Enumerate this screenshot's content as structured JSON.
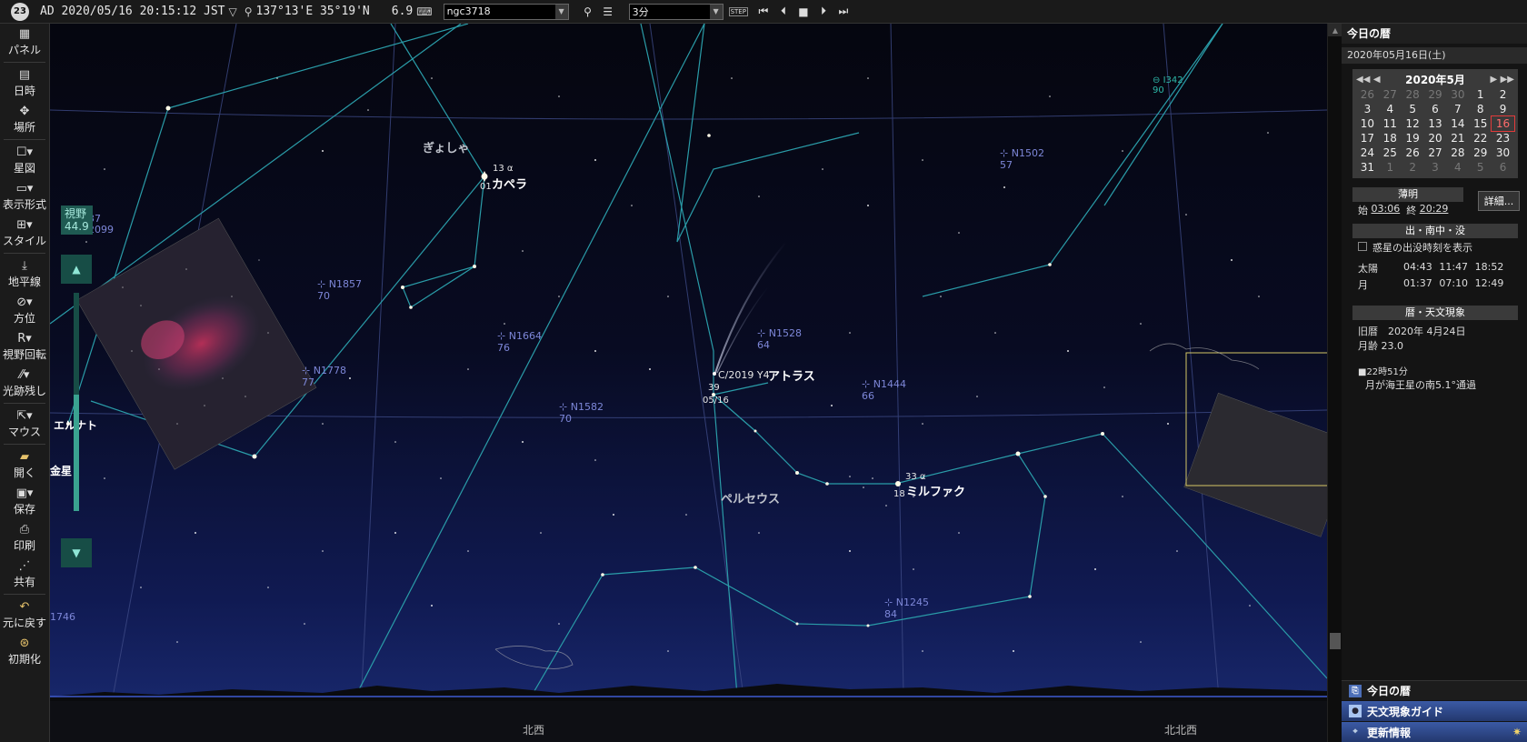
{
  "topbar": {
    "logo_text": "23",
    "datetime": "AD 2020/05/16 20:15:12 JST",
    "location": "137°13'E 35°19'N",
    "fov": "6.9",
    "search_value": "ngc3718",
    "step_value": "3分",
    "step_badge": "STEP"
  },
  "left_toolbar": {
    "items": [
      "パネル",
      "日時",
      "場所",
      "星図",
      "表示形式",
      "スタイル",
      "地平線",
      "方位",
      "視野回転",
      "光跡残し",
      "マウス",
      "開く",
      "保存",
      "印刷",
      "共有",
      "元に戻す",
      "初期化"
    ]
  },
  "sky_controls": {
    "fov_label": "視野",
    "fov_value": "44.9"
  },
  "sky_labels": {
    "constellation_auriga": "ぎょしゃ",
    "constellation_perseus": "ペルセウス",
    "capella_id": "13 α",
    "capella_mag": "01",
    "capella_name": "カペラ",
    "mirfak_id": "33 α",
    "mirfak_mag": "18",
    "mirfak_name": "ミルファク",
    "comet_name": "C/2019 Y4",
    "comet_jp": "アトラス",
    "comet_mag": "39",
    "comet_date": "05/16",
    "venus": "金星",
    "left_partial": "エルナト",
    "dir_nw": "北西",
    "dir_nnw": "北北西",
    "dso": [
      {
        "name": "N1857",
        "mag": "70"
      },
      {
        "name": "N1664",
        "mag": "76"
      },
      {
        "name": "N1778",
        "mag": "77"
      },
      {
        "name": "N1582",
        "mag": "70"
      },
      {
        "name": "N1528",
        "mag": "64"
      },
      {
        "name": "N1444",
        "mag": "66"
      },
      {
        "name": "N1502",
        "mag": "57"
      },
      {
        "name": "N1245",
        "mag": "84"
      },
      {
        "name": "I342",
        "mag": "90"
      }
    ],
    "left_edge_1": "1746",
    "left_edge_2": "37",
    "left_edge_3": "2099"
  },
  "right_panel": {
    "title": "今日の暦",
    "date": "2020年05月16日(土)",
    "calendar": {
      "month_label": "2020年5月",
      "days": [
        {
          "d": "26",
          "dim": true
        },
        {
          "d": "27",
          "dim": true
        },
        {
          "d": "28",
          "dim": true
        },
        {
          "d": "29",
          "dim": true
        },
        {
          "d": "30",
          "dim": true
        },
        {
          "d": "1"
        },
        {
          "d": "2"
        },
        {
          "d": "3"
        },
        {
          "d": "4"
        },
        {
          "d": "5"
        },
        {
          "d": "6"
        },
        {
          "d": "7"
        },
        {
          "d": "8"
        },
        {
          "d": "9"
        },
        {
          "d": "10"
        },
        {
          "d": "11"
        },
        {
          "d": "12"
        },
        {
          "d": "13"
        },
        {
          "d": "14"
        },
        {
          "d": "15"
        },
        {
          "d": "16",
          "today": true
        },
        {
          "d": "17"
        },
        {
          "d": "18"
        },
        {
          "d": "19"
        },
        {
          "d": "20"
        },
        {
          "d": "21"
        },
        {
          "d": "22"
        },
        {
          "d": "23"
        },
        {
          "d": "24"
        },
        {
          "d": "25"
        },
        {
          "d": "26"
        },
        {
          "d": "27"
        },
        {
          "d": "28"
        },
        {
          "d": "29"
        },
        {
          "d": "30"
        },
        {
          "d": "31"
        },
        {
          "d": "1",
          "dim": true
        },
        {
          "d": "2",
          "dim": true
        },
        {
          "d": "3",
          "dim": true
        },
        {
          "d": "4",
          "dim": true
        },
        {
          "d": "5",
          "dim": true
        },
        {
          "d": "6",
          "dim": true
        }
      ]
    },
    "twilight": {
      "title": "薄明",
      "start_label": "始",
      "start": "03:06",
      "end_label": "終",
      "end": "20:29",
      "detail_button": "詳細..."
    },
    "rise_set": {
      "title": "出・南中・没",
      "checkbox_label": "惑星の出没時刻を表示",
      "rows": [
        {
          "name": "太陽",
          "rise": "04:43",
          "transit": "11:47",
          "set": "18:52"
        },
        {
          "name": "月",
          "rise": "01:37",
          "transit": "07:10",
          "set": "12:49"
        }
      ]
    },
    "events": {
      "title": "暦・天文現象",
      "lunar_date": "旧暦　2020年 4月24日",
      "moon_age": "月齢 23.0",
      "event_time": "■22時51分",
      "event_text": "月が海王星の南5.1°通過"
    },
    "tabs": [
      "今日の暦",
      "天文現象ガイド",
      "更新情報"
    ]
  },
  "colors": {
    "sky_top": "#05060f",
    "sky_bottom": "#1a2a6e",
    "constellation_line": "#2a9ca8",
    "grid_line": "#3d4a86",
    "dso_color": "#7d87d8"
  }
}
